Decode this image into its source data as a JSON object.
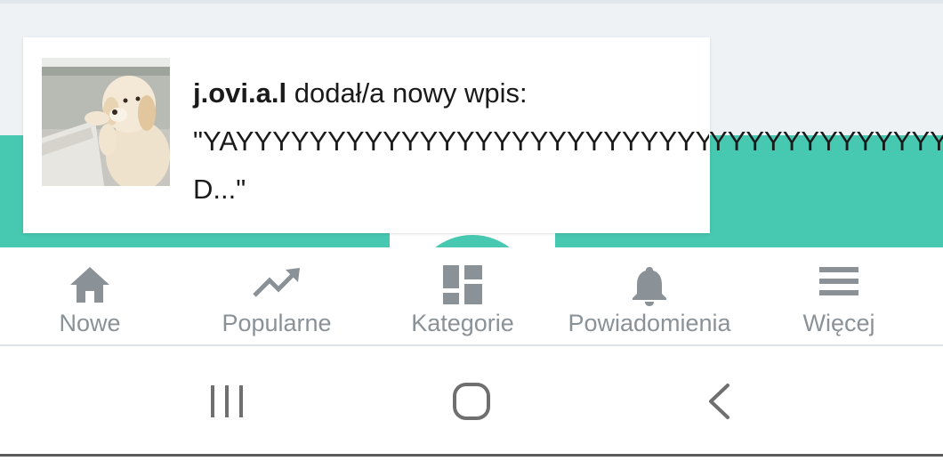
{
  "notification": {
    "username": "j.ovi.a.l",
    "action_text": " dodał/a nowy wpis:",
    "quote_line1": "\"YAYYYYYYYYYYYYYYYYYYYYYYYYYYYYYYYYYYYYYYYYYYYYYYYYYYYYY",
    "quote_line2": "D...\""
  },
  "bottom_nav": {
    "items": [
      {
        "label": "Nowe",
        "icon": "home-icon"
      },
      {
        "label": "Popularne",
        "icon": "trending-up-icon"
      },
      {
        "label": "Kategorie",
        "icon": "dashboard-grid-icon"
      },
      {
        "label": "Powiadomienia",
        "icon": "bell-icon"
      },
      {
        "label": "Więcej",
        "icon": "menu-icon"
      }
    ]
  },
  "system_nav": {
    "buttons": [
      "recent-apps-icon",
      "home-circle-icon",
      "back-icon"
    ]
  },
  "colors": {
    "accent_teal": "#47c8b0",
    "nav_gray": "#8a9298",
    "top_background": "#eef2f5"
  }
}
